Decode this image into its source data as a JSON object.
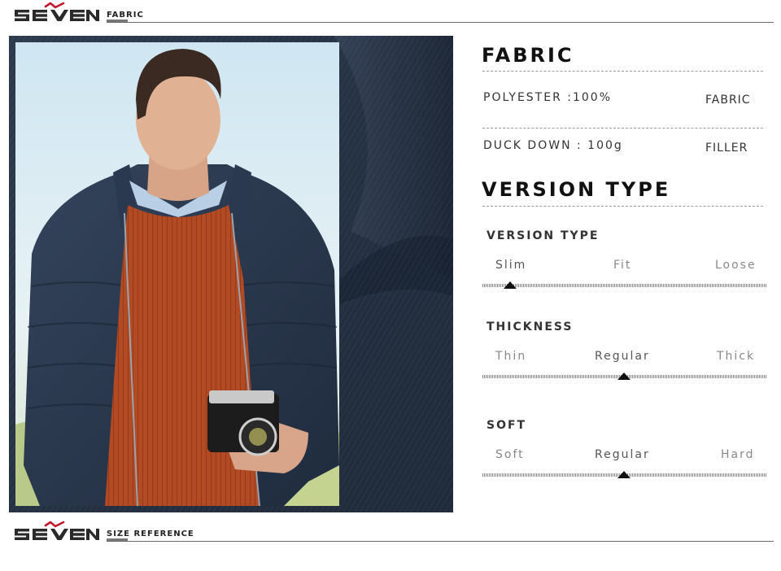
{
  "header": {
    "brand": "SEVEN",
    "section_label": "FABRIC"
  },
  "fabric": {
    "title": "FABRIC",
    "rows": [
      {
        "value": "POLYESTER :100%",
        "label": "FABRIC"
      },
      {
        "value": "DUCK DOWN : 100g",
        "label": "FILLER"
      }
    ]
  },
  "version": {
    "title": "VERSION TYPE",
    "attributes": [
      {
        "name": "VERSION TYPE",
        "options": [
          "Slim",
          "Fit",
          "Loose"
        ],
        "selected": "Slim"
      },
      {
        "name": "THICKNESS",
        "options": [
          "Thin",
          "Regular",
          "Thick"
        ],
        "selected": "Regular"
      },
      {
        "name": "SOFT",
        "options": [
          "Soft",
          "Regular",
          "Hard"
        ],
        "selected": "Regular"
      }
    ]
  },
  "footer": {
    "brand": "SEVEN",
    "section_label": "SIZE REFERENCE"
  },
  "colors": {
    "accent": "#c0182a",
    "navy": "#2a3648",
    "sweater": "#b24a24"
  }
}
